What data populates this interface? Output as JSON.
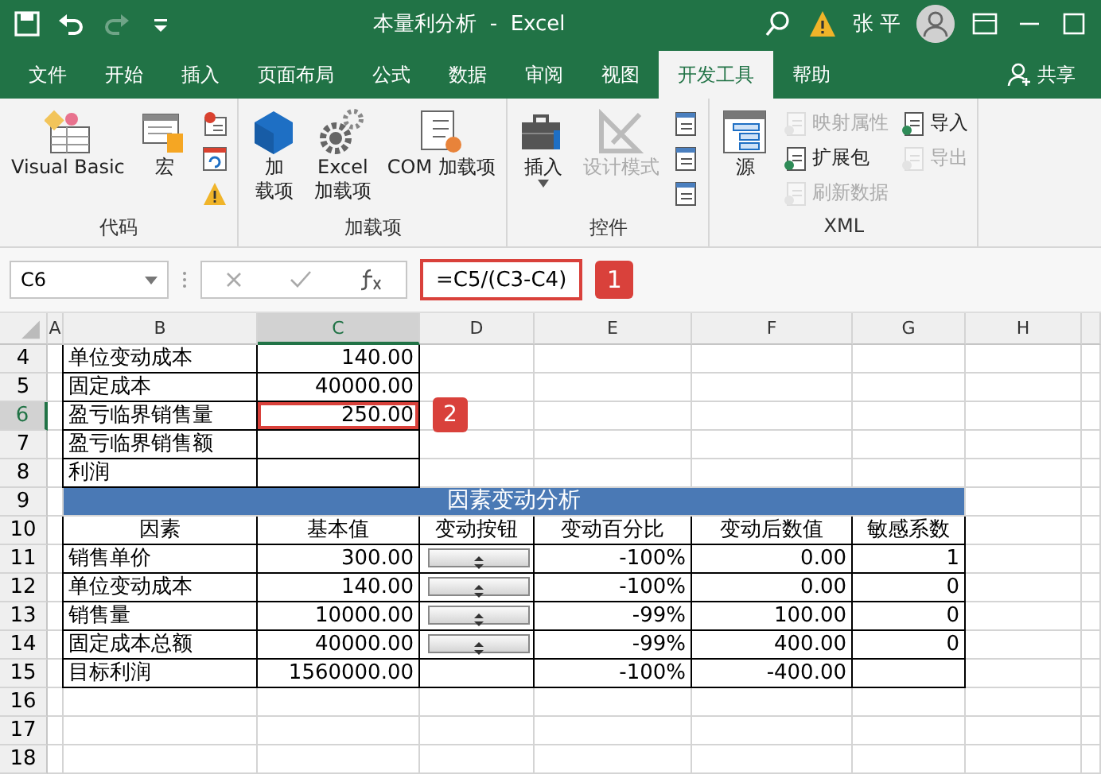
{
  "title_bar": {
    "title": "本量利分析  -  Excel",
    "user": "张 平"
  },
  "tabs": [
    {
      "label": "文件",
      "selected": false
    },
    {
      "label": "开始",
      "selected": false
    },
    {
      "label": "插入",
      "selected": false
    },
    {
      "label": "页面布局",
      "selected": false
    },
    {
      "label": "公式",
      "selected": false
    },
    {
      "label": "数据",
      "selected": false
    },
    {
      "label": "审阅",
      "selected": false
    },
    {
      "label": "视图",
      "selected": false
    },
    {
      "label": "开发工具",
      "selected": true
    },
    {
      "label": "帮助",
      "selected": false
    }
  ],
  "share": "共享",
  "ribbon": [
    {
      "label": "代码",
      "columns": [
        {
          "kind": "large",
          "label": "Visual Basic",
          "disabled": false
        },
        {
          "kind": "large",
          "label": "宏",
          "disabled": false
        },
        {
          "kind": "stack",
          "items": [
            {
              "disabled": false
            },
            {
              "disabled": false
            },
            {
              "disabled": false
            }
          ]
        }
      ]
    },
    {
      "label": "加载项",
      "columns": [
        {
          "kind": "large",
          "lines": [
            "加",
            "载项"
          ],
          "disabled": false
        },
        {
          "kind": "large",
          "lines": [
            "Excel",
            "加载项"
          ],
          "disabled": false
        },
        {
          "kind": "large",
          "label": "COM 加载项",
          "disabled": false
        }
      ]
    },
    {
      "label": "控件",
      "columns": [
        {
          "kind": "large",
          "label": "插入",
          "disabled": false,
          "caret": true
        },
        {
          "kind": "large",
          "label": "设计模式",
          "disabled": true
        },
        {
          "kind": "stack",
          "items": [
            {
              "disabled": false
            },
            {
              "disabled": false
            },
            {
              "disabled": false
            }
          ]
        }
      ]
    },
    {
      "label": "XML",
      "columns": [
        {
          "kind": "large",
          "label": "源",
          "disabled": false
        },
        {
          "kind": "stack",
          "items": [
            {
              "label": "映射属性",
              "disabled": true
            },
            {
              "label": "扩展包",
              "disabled": false
            },
            {
              "label": "刷新数据",
              "disabled": true
            }
          ]
        },
        {
          "kind": "stack",
          "items": [
            {
              "label": "导入",
              "disabled": false
            },
            {
              "label": "导出",
              "disabled": true
            }
          ]
        }
      ]
    }
  ],
  "formula_bar": {
    "name_box": "C6",
    "formula": "=C5/(C3-C4)",
    "callout": "1"
  },
  "columns": [
    {
      "label": "A",
      "selected": false
    },
    {
      "label": "B",
      "selected": false
    },
    {
      "label": "C",
      "selected": true
    },
    {
      "label": "D",
      "selected": false
    },
    {
      "label": "E",
      "selected": false
    },
    {
      "label": "F",
      "selected": false
    },
    {
      "label": "G",
      "selected": false
    },
    {
      "label": "H",
      "selected": false
    }
  ],
  "rows": [
    {
      "num": "4",
      "selected": false,
      "kind": "input",
      "label": "单位变动成本",
      "value": "140.00"
    },
    {
      "num": "5",
      "selected": false,
      "kind": "input",
      "label": "固定成本",
      "value": "40000.00"
    },
    {
      "num": "6",
      "selected": true,
      "kind": "input",
      "label": "盈亏临界销售量",
      "value": "250.00",
      "callout": "2"
    },
    {
      "num": "7",
      "selected": false,
      "kind": "input",
      "label": "盈亏临界销售额"
    },
    {
      "num": "8",
      "selected": false,
      "kind": "input",
      "label": "利润"
    },
    {
      "num": "9",
      "selected": false,
      "kind": "title",
      "text": "因素变动分析"
    },
    {
      "num": "10",
      "selected": false,
      "kind": "header",
      "cells": [
        "因素",
        "基本值",
        "变动按钮",
        "变动百分比",
        "变动后数值",
        "敏感系数"
      ]
    },
    {
      "num": "11",
      "selected": false,
      "kind": "data",
      "factor": "销售单价",
      "base": "300.00",
      "spinner": true,
      "pct": "-100%",
      "after": "0.00",
      "coef": "1"
    },
    {
      "num": "12",
      "selected": false,
      "kind": "data",
      "factor": "单位变动成本",
      "base": "140.00",
      "spinner": true,
      "pct": "-100%",
      "after": "0.00",
      "coef": "0"
    },
    {
      "num": "13",
      "selected": false,
      "kind": "data",
      "factor": "销售量",
      "base": "10000.00",
      "spinner": true,
      "pct": "-99%",
      "after": "100.00",
      "coef": "0"
    },
    {
      "num": "14",
      "selected": false,
      "kind": "data",
      "factor": "固定成本总额",
      "base": "40000.00",
      "spinner": true,
      "pct": "-99%",
      "after": "400.00",
      "coef": "0"
    },
    {
      "num": "15",
      "selected": false,
      "kind": "data",
      "factor": "目标利润",
      "base": "1560000.00",
      "spinner": false,
      "pct": "-100%",
      "after": "-400.00"
    },
    {
      "num": "16",
      "selected": false,
      "kind": "blank"
    },
    {
      "num": "17",
      "selected": false,
      "kind": "blank"
    },
    {
      "num": "18",
      "selected": false,
      "kind": "blank"
    }
  ]
}
